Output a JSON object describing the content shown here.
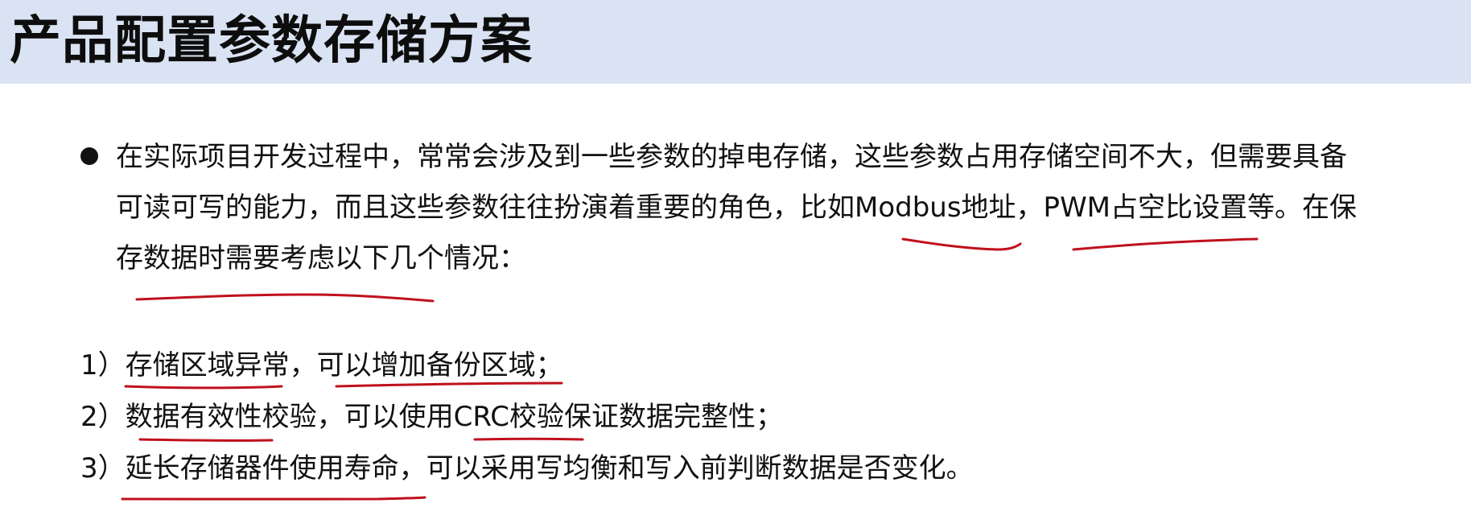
{
  "slide": {
    "title": "产品配置参数存储方案",
    "paragraph": {
      "lines": [
        "在实际项目开发过程中，常常会涉及到一些参数的掉电存储，这些参数占用存储空间不大，但需要具备",
        "可读可写的能力，而且这些参数往往扮演着重要的角色，比如Modbus地址，PWM占空比设置等。在保",
        "存数据时需要考虑以下几个情况："
      ]
    },
    "list": [
      "1）存储区域异常，可以增加备份区域；",
      "2）数据有效性校验，可以使用CRC校验保证数据完整性；",
      "3）延长存储器件使用寿命，可以采用写均衡和写入前判断数据是否变化。"
    ],
    "annotation_color": "#c0101c"
  }
}
